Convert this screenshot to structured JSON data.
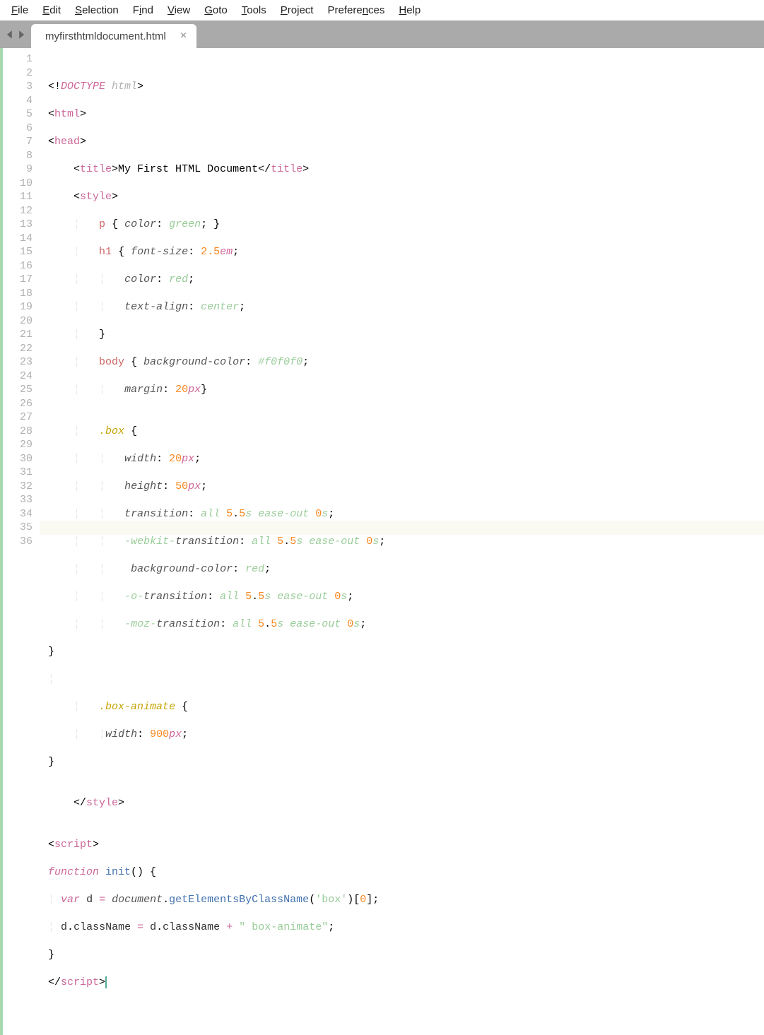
{
  "menu": {
    "file": "File",
    "edit": "Edit",
    "selection": "Selection",
    "find": "Find",
    "view": "View",
    "goto": "Goto",
    "tools": "Tools",
    "project": "Project",
    "preferences": "Preferences",
    "help": "Help"
  },
  "tab": {
    "name": "myfirsthtmldocument.html"
  },
  "gutter_start": 1,
  "gutter_end": 36,
  "current_line": 35,
  "code": {
    "l1": {
      "doctype": "DOCTYPE",
      "html": "html"
    },
    "l2": {
      "tag": "html"
    },
    "l3": {
      "tag": "head"
    },
    "l4": {
      "tag": "title",
      "text": "My First HTML Document"
    },
    "l5": {
      "tag": "style"
    },
    "l6": {
      "sel": "p",
      "prop": "color",
      "val": "green"
    },
    "l7": {
      "sel": "h1",
      "prop": "font-size",
      "num": "2.5",
      "unit": "em"
    },
    "l8": {
      "prop": "color",
      "val": "red"
    },
    "l9": {
      "prop": "text-align",
      "val": "center"
    },
    "l11": {
      "sel": "body",
      "prop": "background-color",
      "val": "#f0f0f0"
    },
    "l12": {
      "prop": "margin",
      "num": "20",
      "unit": "px"
    },
    "l14": {
      "cls": ".box"
    },
    "l15": {
      "prop": "width",
      "num": "20",
      "unit": "px"
    },
    "l16": {
      "prop": "height",
      "num": "50",
      "unit": "px"
    },
    "l17": {
      "prop": "transition",
      "all": "all",
      "n1": "5",
      "n2": "5",
      "s": "s",
      "ease": "ease-out",
      "z": "0"
    },
    "l18": {
      "pre": "-webkit-",
      "prop": "transition",
      "all": "all",
      "n1": "5",
      "n2": "5",
      "s": "s",
      "ease": "ease-out",
      "z": "0"
    },
    "l19": {
      "prop": "background-color",
      "val": "red"
    },
    "l20": {
      "pre": "-o-",
      "prop": "transition",
      "all": "all",
      "n1": "5",
      "n2": "5",
      "s": "s",
      "ease": "ease-out",
      "z": "0"
    },
    "l21": {
      "pre": "-moz-",
      "prop": "transition",
      "all": "all",
      "n1": "5",
      "n2": "5",
      "s": "s",
      "ease": "ease-out",
      "z": "0"
    },
    "l24": {
      "cls": ".box-animate"
    },
    "l25": {
      "prop": "width",
      "num": "900",
      "unit": "px"
    },
    "l28": {
      "tag": "style"
    },
    "l30": {
      "tag": "script"
    },
    "l31": {
      "fn": "function",
      "name": "init"
    },
    "l32": {
      "var": "var",
      "d": "d",
      "doc": "document",
      "method": "getElementsByClassName",
      "arg": "'box'",
      "idx": "0"
    },
    "l33": {
      "d": "d",
      "cn": "className",
      "str": "\" box-animate\""
    },
    "l35": {
      "tag": "script"
    }
  }
}
